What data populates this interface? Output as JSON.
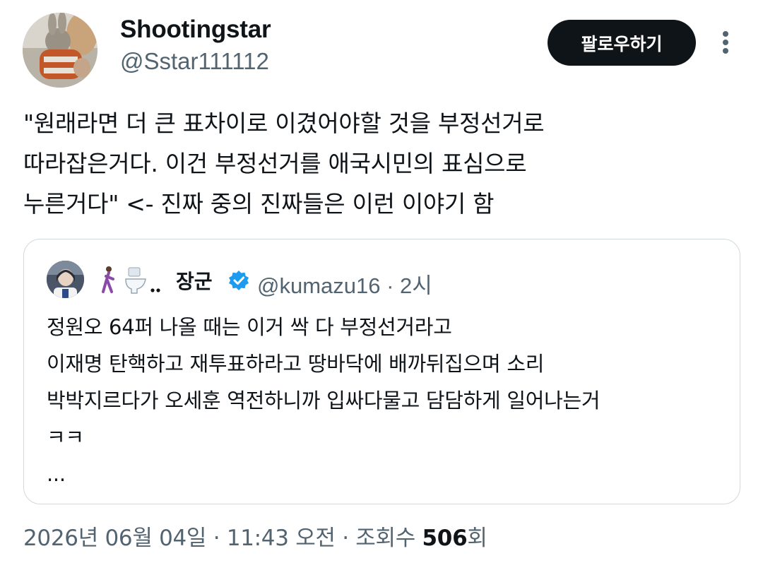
{
  "author": {
    "display_name": "Shootingstar",
    "handle": "@Sstar111112",
    "avatar_icon": "avatar-rabbit-photo"
  },
  "actions": {
    "follow_label": "팔로우하기",
    "more_icon": "more-vertical-icon"
  },
  "tweet": {
    "text": "\"원래라면 더 큰 표차이로 이겼어야할 것을 부정선거로\n따라잡은거다. 이건 부정선거를 애국시민의 표심으로\n누른거다\" <- 진짜 중의 진짜들은 이런 이야기 함"
  },
  "quoted_tweet": {
    "emojis": "🚶‍♀️🚽..",
    "display_name": "장군",
    "verified_icon": "verified-badge-icon",
    "handle_time": "@kumazu16 · 2시",
    "text": "정원오 64퍼 나올 때는 이거 싹 다 부정선거라고\n이재명 탄핵하고 재투표하라고 땅바닥에 배까뒤집으며 소리\n박박지르다가 오세훈 역전하니까 입싸다물고 담담하게 일어나는거\nㅋㅋ\n...",
    "accent_color": "#1d9bf0"
  },
  "meta": {
    "timestamp": "2026년 06월 04일 · 11:43 오전 · 조회수 ",
    "views": "506",
    "views_suffix": "회"
  }
}
